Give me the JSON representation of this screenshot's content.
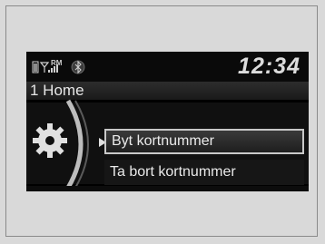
{
  "status": {
    "time": "12:34",
    "icons": [
      "phone-icon",
      "signal-icon",
      "bluetooth-icon"
    ],
    "roam_label": "RM"
  },
  "header": {
    "title": "1 Home"
  },
  "menu": {
    "items": [
      {
        "label": "Byt kortnummer",
        "selected": true
      },
      {
        "label": "Ta bort kortnummer",
        "selected": false
      }
    ]
  },
  "colors": {
    "screen_bg": "#000000",
    "text": "#eaeaea",
    "highlight_border": "#c8c8c8",
    "page_bg": "#d9d9d9"
  }
}
